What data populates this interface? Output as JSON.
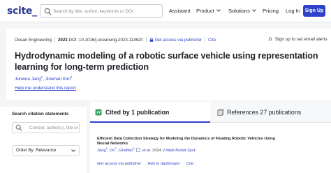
{
  "nav": {
    "logo": "scite_",
    "search_placeholder": "Search by title, author, keywords or DOI",
    "assistant": "Assistant",
    "product": "Product",
    "solutions": "Solutions",
    "pricing": "Pricing",
    "login": "Log In",
    "signup": "Sign Up"
  },
  "paper": {
    "journal": "Ocean Engineering",
    "year": "2023",
    "doi": "DOI: 10.1016/j.oceaneng.2023.113620",
    "access": "Get access via publisher",
    "cite": "Cite",
    "alerts": "Sign up to set email alerts",
    "title": "Hydrodynamic modeling of a robotic surface vehicle using representation learning for long-term prediction",
    "author1": "Junwoo Jang",
    "author1_sup": "1",
    "author2": "Jinwhan Kim",
    "author2_sup": "2",
    "help": "Help me understand this report"
  },
  "filters": {
    "label": "Search citation statements",
    "placeholder": "Context, author(s), title etc",
    "order": "Order By: Relevance"
  },
  "tabs": {
    "cited": "Cited by 1 publication",
    "references": "References 27 publications"
  },
  "entry": {
    "title": "Efficient Data Collection Strategy for Modeling the Dynamics of Floating Robotic Vehicles Using Neural Networks",
    "author_a": "Jang",
    "author_a_sup": "1",
    "author_b": "Do",
    "author_b_sup": "2",
    "author_c": "Ghaffari",
    "author_c_sup": "3",
    "etal": "et al.",
    "year": "2024",
    "journal": "J Intell Robot Syst",
    "access": "Get access via publisher",
    "dashboard": "Add to dashboard",
    "cite": "Cite"
  },
  "colors": {
    "accent": "#2f42c8",
    "logo": "#2a3a8f",
    "page_bg": "#f4f5f7"
  }
}
